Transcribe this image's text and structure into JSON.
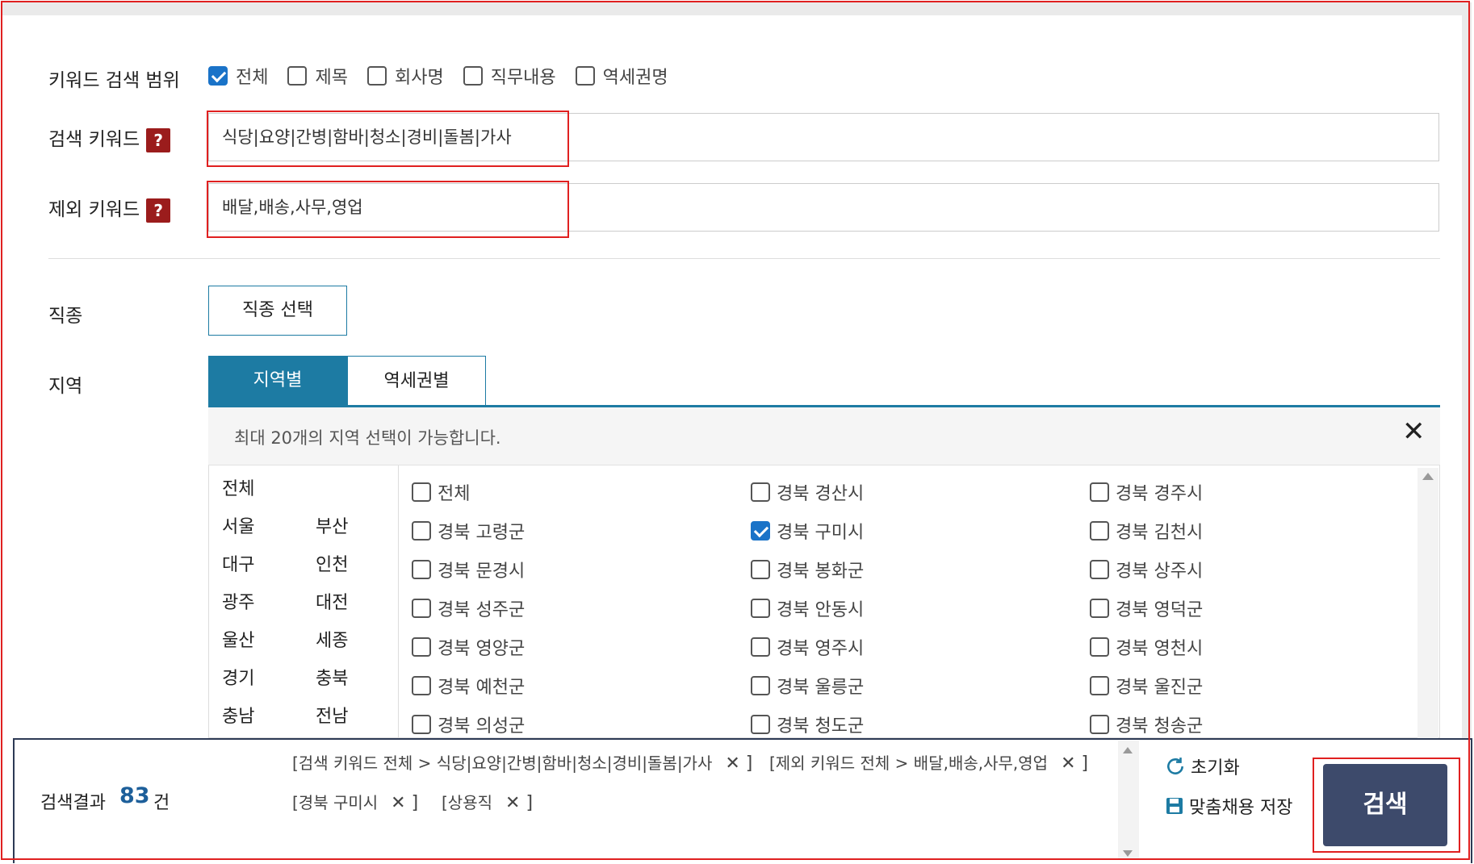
{
  "keyword_scope": {
    "label": "키워드 검색 범위",
    "options": [
      {
        "label": "전체",
        "checked": true
      },
      {
        "label": "제목",
        "checked": false
      },
      {
        "label": "회사명",
        "checked": false
      },
      {
        "label": "직무내용",
        "checked": false
      },
      {
        "label": "역세권명",
        "checked": false
      }
    ]
  },
  "search_keyword": {
    "label": "검색 키워드",
    "help": "?",
    "value": "식당|요양|간병|함바|청소|경비|돌봄|가사"
  },
  "exclude_keyword": {
    "label": "제외 키워드",
    "help": "?",
    "value": "배달,배송,사무,영업"
  },
  "job_type": {
    "label": "직종",
    "button": "직종 선택"
  },
  "region": {
    "label": "지역",
    "tabs": [
      "지역별",
      "역세권별"
    ],
    "notice": "최대 20개의 지역 선택이 가능합니다.",
    "close": "✕",
    "provinces": [
      "전체",
      "서울",
      "부산",
      "대구",
      "인천",
      "광주",
      "대전",
      "울산",
      "세종",
      "경기",
      "충북",
      "충남",
      "전남"
    ],
    "districts": [
      {
        "label": "전체",
        "checked": false
      },
      {
        "label": "경북 경산시",
        "checked": false
      },
      {
        "label": "경북 경주시",
        "checked": false
      },
      {
        "label": "경북 고령군",
        "checked": false
      },
      {
        "label": "경북 구미시",
        "checked": true
      },
      {
        "label": "경북 김천시",
        "checked": false
      },
      {
        "label": "경북 문경시",
        "checked": false
      },
      {
        "label": "경북 봉화군",
        "checked": false
      },
      {
        "label": "경북 상주시",
        "checked": false
      },
      {
        "label": "경북 성주군",
        "checked": false
      },
      {
        "label": "경북 안동시",
        "checked": false
      },
      {
        "label": "경북 영덕군",
        "checked": false
      },
      {
        "label": "경북 영양군",
        "checked": false
      },
      {
        "label": "경북 영주시",
        "checked": false
      },
      {
        "label": "경북 영천시",
        "checked": false
      },
      {
        "label": "경북 예천군",
        "checked": false
      },
      {
        "label": "경북 울릉군",
        "checked": false
      },
      {
        "label": "경북 울진군",
        "checked": false
      },
      {
        "label": "경북 의성군",
        "checked": false
      },
      {
        "label": "경북 청도군",
        "checked": false
      },
      {
        "label": "경북 청송군",
        "checked": false
      }
    ]
  },
  "results": {
    "label": "검색결과",
    "count": "83",
    "unit": "건",
    "tags": [
      "[검색 키워드 전체 > 식당|요양|간병|함바|청소|경비|돌봄|가사",
      "[제외 키워드 전체 > 배달,배송,사무,영업",
      "[경북 구미시",
      "[상용직"
    ],
    "tag_close": "✕ ]"
  },
  "actions": {
    "reset": "초기화",
    "save": "맞춤채용 저장",
    "search": "검색"
  },
  "colors": {
    "accent": "#1d7ba3",
    "help_bg": "#9b1c1c",
    "search_bg": "#3d4a6b",
    "highlight": "#e02020",
    "check": "#1a73c8"
  }
}
